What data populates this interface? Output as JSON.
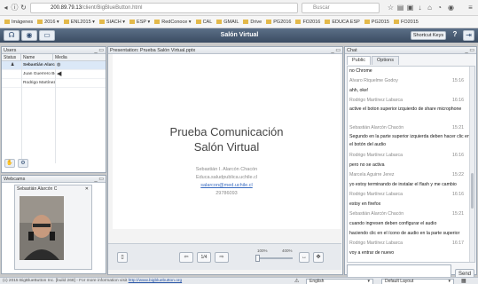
{
  "browser": {
    "url_host": "200.89.79.13",
    "url_path": "/client/BigBlueButton.html",
    "search_placeholder": "Buscar",
    "bookmarks": [
      {
        "label": "Imágenes",
        "icon": "gear-icon"
      },
      {
        "label": "2016 ▾",
        "icon": "folder-icon"
      },
      {
        "label": "ENL2015 ▾",
        "icon": "folder-icon"
      },
      {
        "label": "SIACH ▾",
        "icon": "folder-icon"
      },
      {
        "label": "ESP ▾",
        "icon": "folder-icon"
      },
      {
        "label": "RedConoce ▾",
        "icon": "folder-icon"
      },
      {
        "label": "CAL",
        "icon": "calendar-icon"
      },
      {
        "label": "GMAIL",
        "icon": "mail-icon"
      },
      {
        "label": "Drive",
        "icon": "drive-icon"
      },
      {
        "label": "PG2016",
        "icon": "bookmark-icon"
      },
      {
        "label": "FO2016",
        "icon": "bookmark-icon"
      },
      {
        "label": "EDUCA ESP",
        "icon": "bookmark-icon"
      },
      {
        "label": "PG2015",
        "icon": "bookmark-icon"
      },
      {
        "label": "FO2015",
        "icon": "bookmark-icon"
      }
    ]
  },
  "app": {
    "title": "Salón Virtual",
    "shortcut_label": "Shortcut Keys",
    "help_label": "?"
  },
  "users": {
    "title": "Users",
    "columns": [
      "Status",
      "Name",
      "Media"
    ],
    "rows": [
      {
        "name": "Sebastián Alarcón C",
        "selected": true
      },
      {
        "name": "Juan Guerrero Bonne",
        "selected": false
      },
      {
        "name": "Rodrigo Martínez Lab",
        "selected": false
      }
    ]
  },
  "webcams": {
    "title": "Webcams",
    "cam_name": "Sebastián Alarcón C",
    "close": "✕"
  },
  "presentation": {
    "title": "Presentation: Prueba Salón Virtual.pptx",
    "slide_title_1": "Prueba Comunicación",
    "slide_title_2": "Salón Virtual",
    "author": "Sebastián I. Alarcón Chacón",
    "org": "Educa.saludpublica.uchile.cl",
    "email": "salarcon@med.uchile.cl",
    "phone": "29786093",
    "page": "1/4",
    "zoom_min": "100%",
    "zoom_max": "400%"
  },
  "chat": {
    "title": "Chat",
    "tab_public": "Public",
    "tab_options": "Options",
    "messages": [
      {
        "kind": "text",
        "text": "no Chrome"
      },
      {
        "kind": "name",
        "name": "Alvaro Riquelme Godoy",
        "time": "15:16"
      },
      {
        "kind": "text",
        "text": "ahh, oke!"
      },
      {
        "kind": "name",
        "name": "Rodrigo Martínez Labarca",
        "time": "16:16"
      },
      {
        "kind": "text2",
        "text": "active el boton superior izquierdo de share microphone"
      },
      {
        "kind": "name",
        "name": "Sebastián Alarcón Chacón",
        "time": "15:21"
      },
      {
        "kind": "text2",
        "text": "Segundo en la parte superior izquierda deben hacer clic en el botón del audio"
      },
      {
        "kind": "name",
        "name": "Rodrigo Martínez Labarca",
        "time": "16:16"
      },
      {
        "kind": "text",
        "text": "pero no se activa"
      },
      {
        "kind": "name",
        "name": "Marcela Aguirre Jerez",
        "time": "15:22"
      },
      {
        "kind": "text",
        "text": "yo estoy terminando de instalar el flash y me cambio"
      },
      {
        "kind": "name",
        "name": "Rodrigo Martínez Labarca",
        "time": "16:16"
      },
      {
        "kind": "text",
        "text": "estoy en firefox"
      },
      {
        "kind": "name",
        "name": "Sebastián Alarcón Chacón",
        "time": "15:21"
      },
      {
        "kind": "text",
        "text": "cuando ingresen deben configurar el audio"
      },
      {
        "kind": "text",
        "text": "haciendo clic en el ícono de audio en la parte superior"
      },
      {
        "kind": "name",
        "name": "Rodrigo Martínez Labarca",
        "time": "16:17"
      },
      {
        "kind": "text",
        "text": "voy a entrar de nuevo"
      }
    ],
    "send_label": "Send"
  },
  "status": {
    "copyright": "(c) 2015 BigBlueButton Inc. [build 268] - For more information visit",
    "link": "http://www.bigbluebutton.org",
    "language": "English",
    "layout": "Default Layout"
  },
  "colors": {
    "header": "#3b4c62",
    "panel_border": "#9aa6b4",
    "link": "#2a57a8"
  }
}
